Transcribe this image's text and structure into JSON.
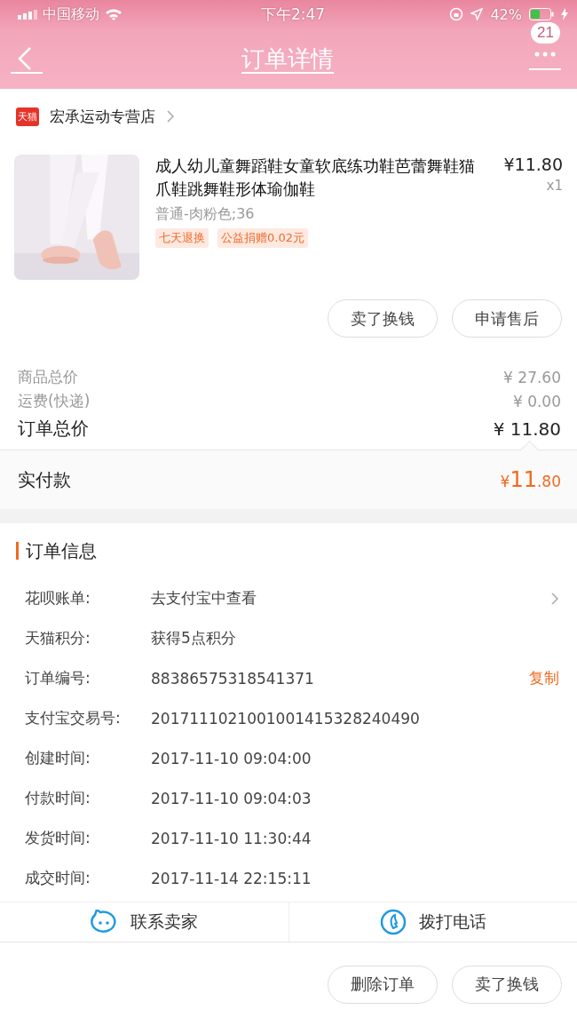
{
  "status_bar": {
    "carrier": "中国移动",
    "time": "下午2:47",
    "battery": "42%"
  },
  "nav": {
    "title": "订单详情",
    "badge": "21"
  },
  "store": {
    "badge": "天猫",
    "name": "宏承运动专营店"
  },
  "product": {
    "kind": "picture",
    "title": "成人幼儿童舞蹈鞋女童软底练功鞋芭蕾舞鞋猫爪鞋跳舞鞋形体瑜伽鞋",
    "price": "¥11.80",
    "quantity": "x1",
    "spec": "普通-肉粉色;36",
    "tags": [
      "七天退换",
      "公益捐赠0.02元"
    ]
  },
  "item_buttons": [
    "卖了换钱",
    "申请售后"
  ],
  "prices": [
    {
      "kind": "minor",
      "label": "商品总价",
      "value": "¥ 27.60"
    },
    {
      "kind": "minor",
      "label": "运费(快递)",
      "value": "¥ 0.00"
    },
    {
      "kind": "total",
      "label": "订单总价",
      "value": "¥ 11.80"
    }
  ],
  "paid": {
    "label": "实付款",
    "currency": "¥",
    "integer": "11",
    "decimal": ".80"
  },
  "order_info": {
    "title": "订单信息",
    "rows": [
      {
        "kind": "link",
        "label": "花呗账单:",
        "value": "去支付宝中查看"
      },
      {
        "kind": "plain",
        "label": "天猫积分:",
        "value": "获得5点积分"
      },
      {
        "kind": "copy",
        "label": "订单编号:",
        "value": "88386575318541371",
        "action": "复制"
      },
      {
        "kind": "plain",
        "label": "支付宝交易号:",
        "value": "2017111021001001415328240490"
      },
      {
        "kind": "plain",
        "label": "创建时间:",
        "value": "2017-11-10 09:04:00"
      },
      {
        "kind": "plain",
        "label": "付款时间:",
        "value": "2017-11-10 09:04:03"
      },
      {
        "kind": "plain",
        "label": "发货时间:",
        "value": "2017-11-10 11:30:44"
      },
      {
        "kind": "plain",
        "label": "成交时间:",
        "value": "2017-11-14 22:15:11"
      }
    ]
  },
  "contact": [
    {
      "kind": "chat",
      "label": "联系卖家"
    },
    {
      "kind": "phone",
      "label": "拨打电话"
    }
  ],
  "bottom_buttons": [
    "删除订单",
    "卖了换钱"
  ]
}
